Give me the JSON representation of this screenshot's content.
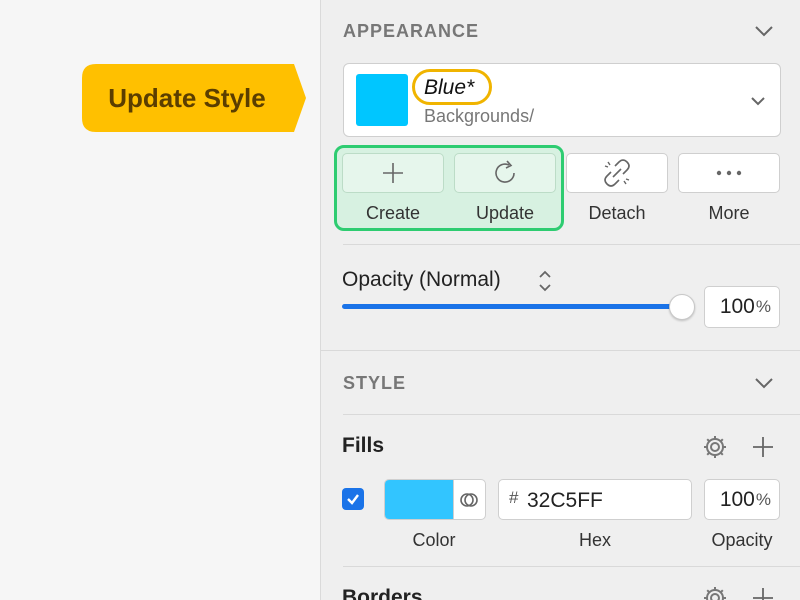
{
  "callout": {
    "text": "Update Style",
    "color": "#ffc000"
  },
  "appearance": {
    "section_title": "APPEARANCE",
    "style_name": "Blue*",
    "style_path": "Backgrounds/",
    "swatch_color": "#00c6ff",
    "actions": [
      {
        "label": "Create",
        "icon": "plus-icon"
      },
      {
        "label": "Update",
        "icon": "refresh-icon"
      },
      {
        "label": "Detach",
        "icon": "unlink-icon"
      },
      {
        "label": "More",
        "icon": "ellipsis-icon"
      }
    ],
    "opacity_label": "Opacity (Normal)",
    "opacity_value": "100",
    "opacity_unit": "%",
    "opacity_level": 1.0
  },
  "style": {
    "section_title": "STYLE",
    "fills": {
      "title": "Fills",
      "enabled": true,
      "hex_prefix": "#",
      "hex": "32C5FF",
      "color": "#32c5ff",
      "opacity_value": "100",
      "opacity_unit": "%",
      "labels": {
        "color": "Color",
        "hex": "Hex",
        "opacity": "Opacity"
      }
    },
    "borders": {
      "title": "Borders"
    }
  }
}
